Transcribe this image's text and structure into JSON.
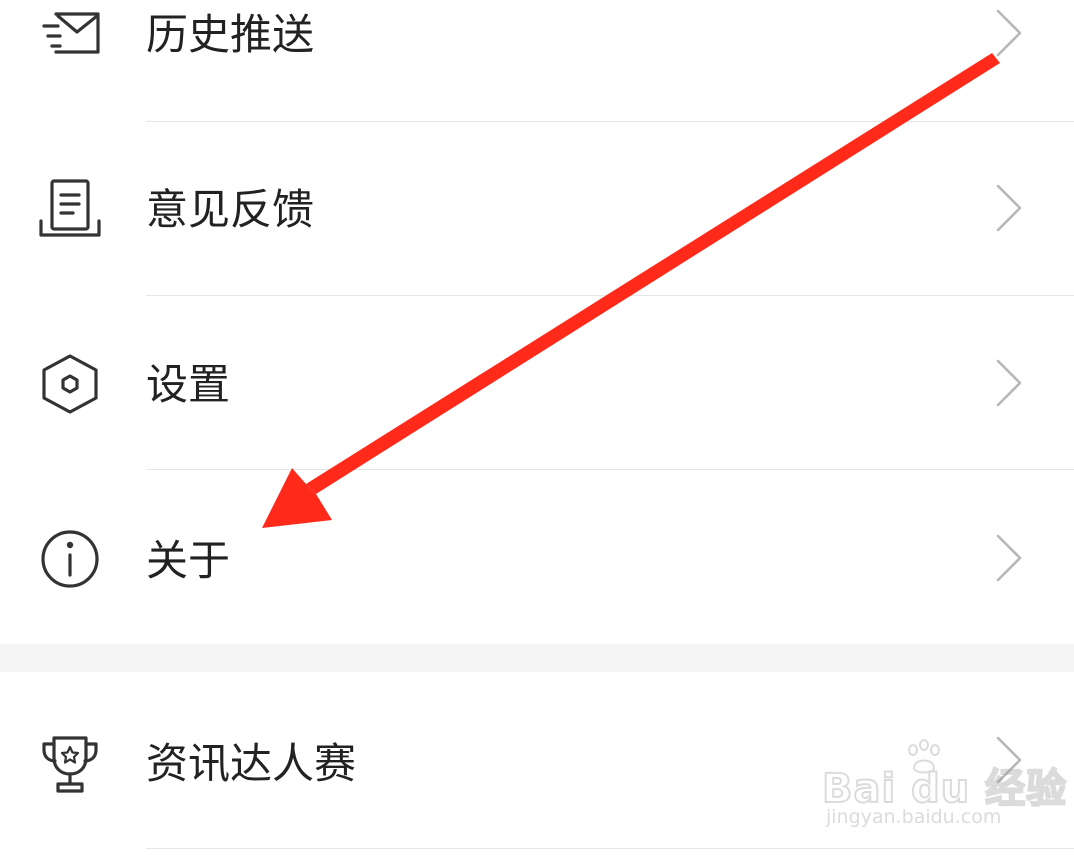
{
  "menu": {
    "items": [
      {
        "label": "历史推送",
        "icon": "envelope-send-icon"
      },
      {
        "label": "意见反馈",
        "icon": "feedback-document-icon"
      },
      {
        "label": "设置",
        "icon": "hexagon-settings-icon"
      },
      {
        "label": "关于",
        "icon": "info-circle-icon"
      }
    ],
    "section2": [
      {
        "label": "资讯达人赛",
        "icon": "trophy-icon"
      }
    ]
  },
  "annotation": {
    "arrow_color": "#ff2a1a"
  },
  "watermark": {
    "brand": "Bai du 经验",
    "url": "jingyan.baidu.com"
  },
  "colors": {
    "text": "#222222",
    "icon": "#333333",
    "chevron": "#b8b8b8",
    "divider": "#e6e6e6",
    "gap": "#f5f5f5"
  }
}
